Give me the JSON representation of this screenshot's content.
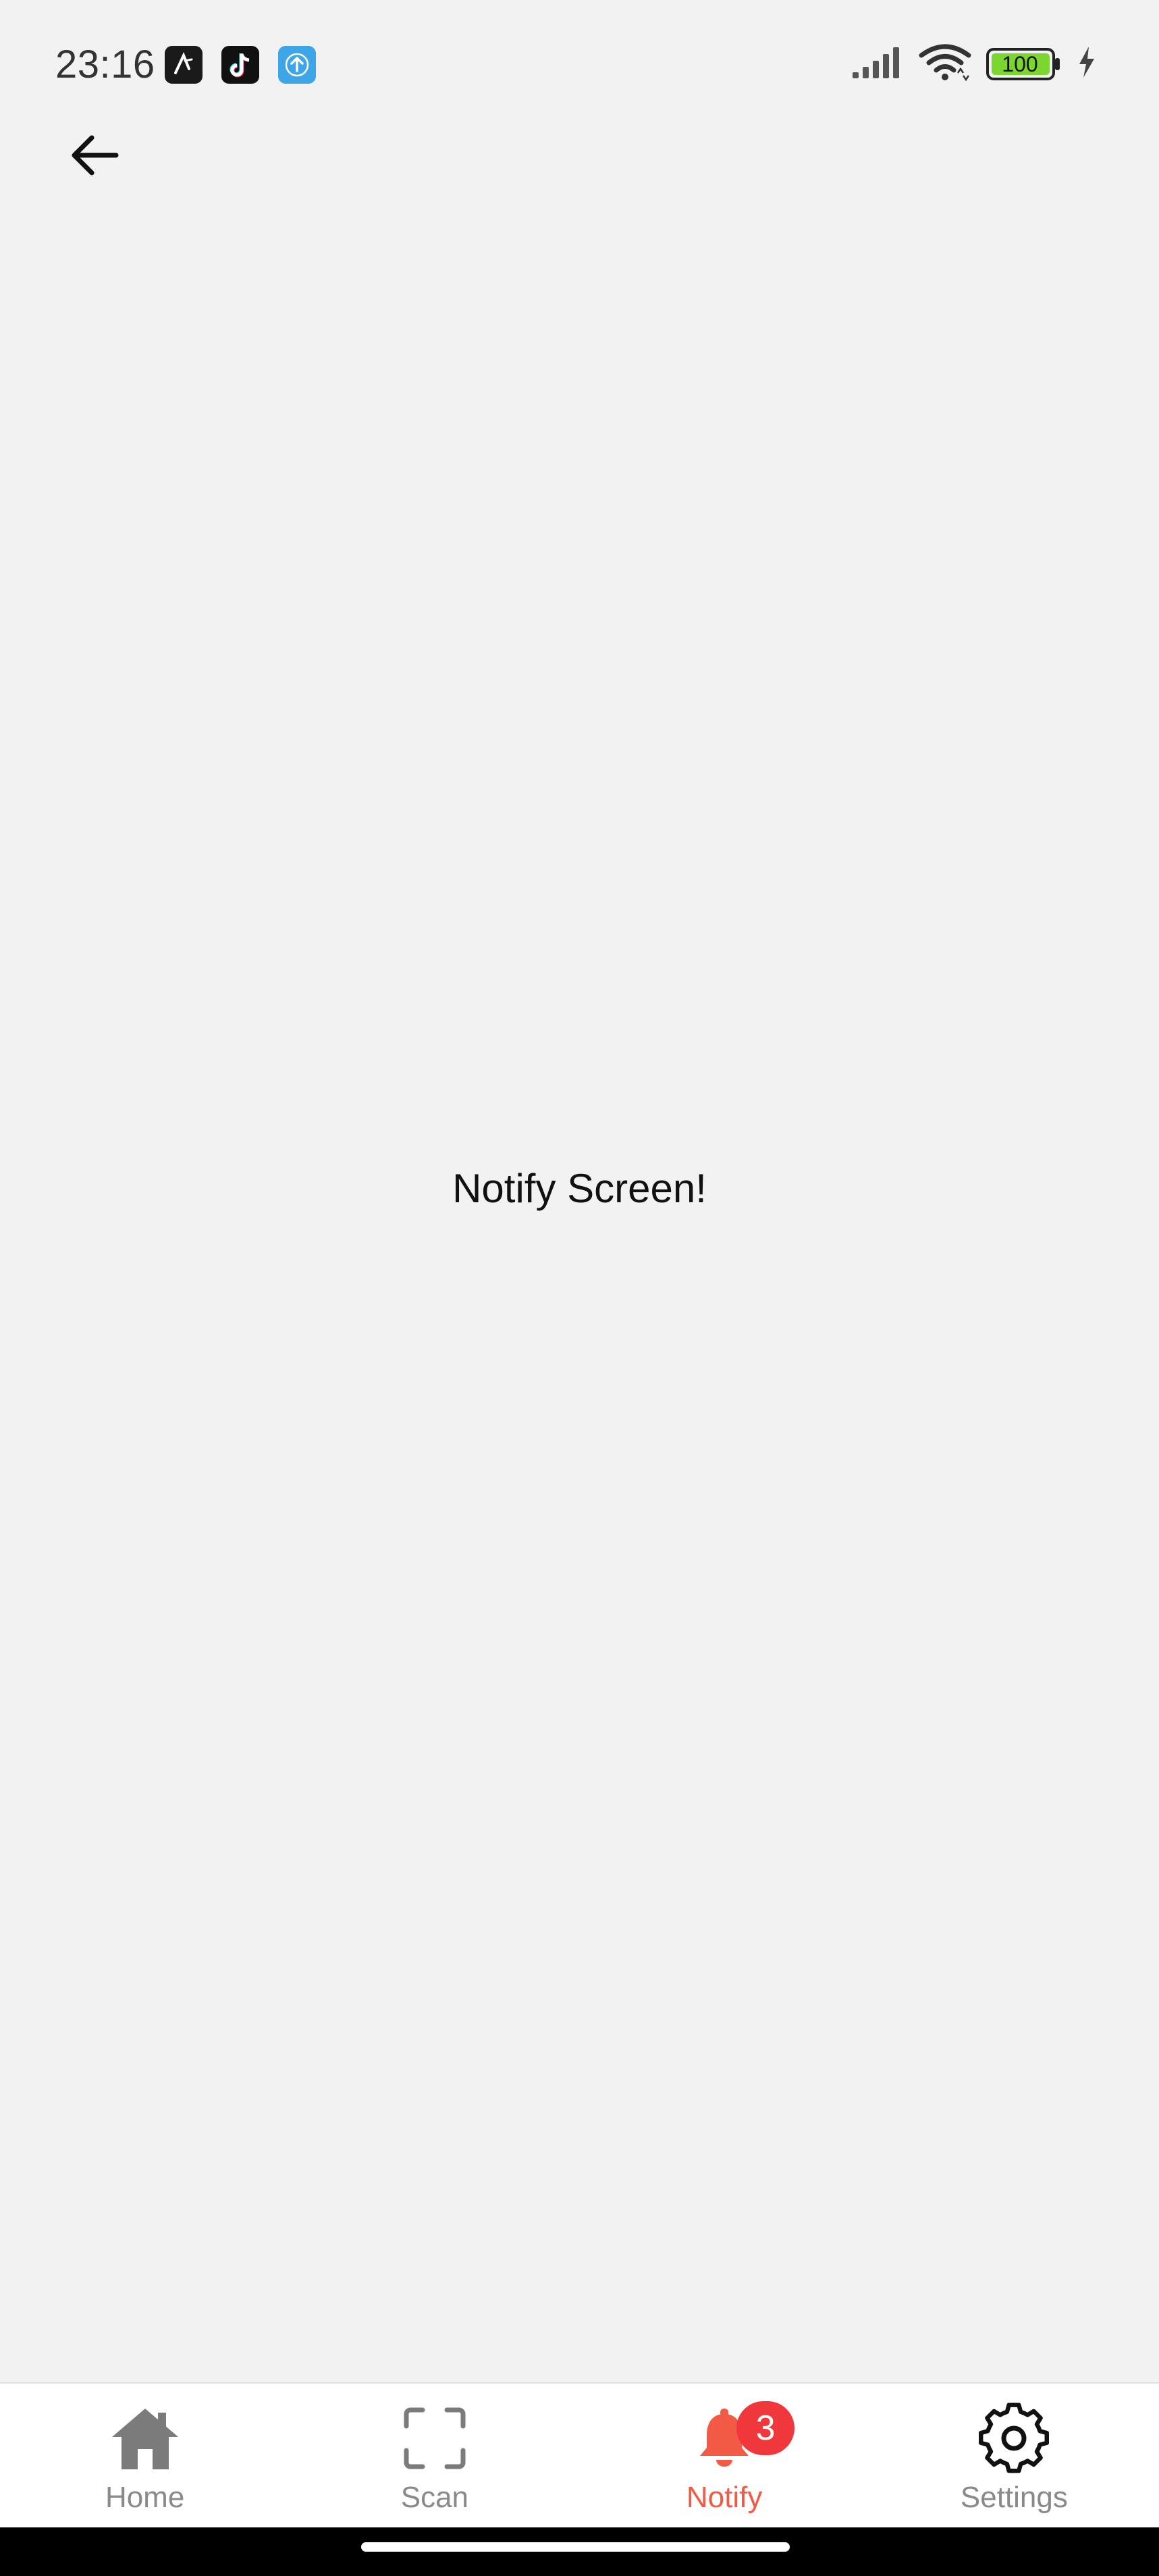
{
  "status_bar": {
    "time": "23:16",
    "notification_icons": [
      "drawing-app-icon",
      "tiktok-icon",
      "upload-arrow-icon"
    ],
    "signal_icon": "cellular-signal-icon",
    "wifi_icon": "wifi-icon",
    "battery_level": "100",
    "charging_icon": "charging-bolt-icon"
  },
  "header": {
    "back_icon": "back-arrow-icon"
  },
  "main": {
    "message": "Notify Screen!"
  },
  "tab_bar": {
    "active_color": "#f25a45",
    "inactive_color": "#8a8a8a",
    "tabs": [
      {
        "label": "Home",
        "icon": "home-icon",
        "active": false
      },
      {
        "label": "Scan",
        "icon": "scan-icon",
        "active": false
      },
      {
        "label": "Notify",
        "icon": "bell-icon",
        "active": true,
        "badge": "3"
      },
      {
        "label": "Settings",
        "icon": "gear-icon",
        "active": false
      }
    ]
  },
  "colors": {
    "background": "#f2f2f3",
    "badge": "#f0373b",
    "battery_fill": "#7bd62f"
  }
}
